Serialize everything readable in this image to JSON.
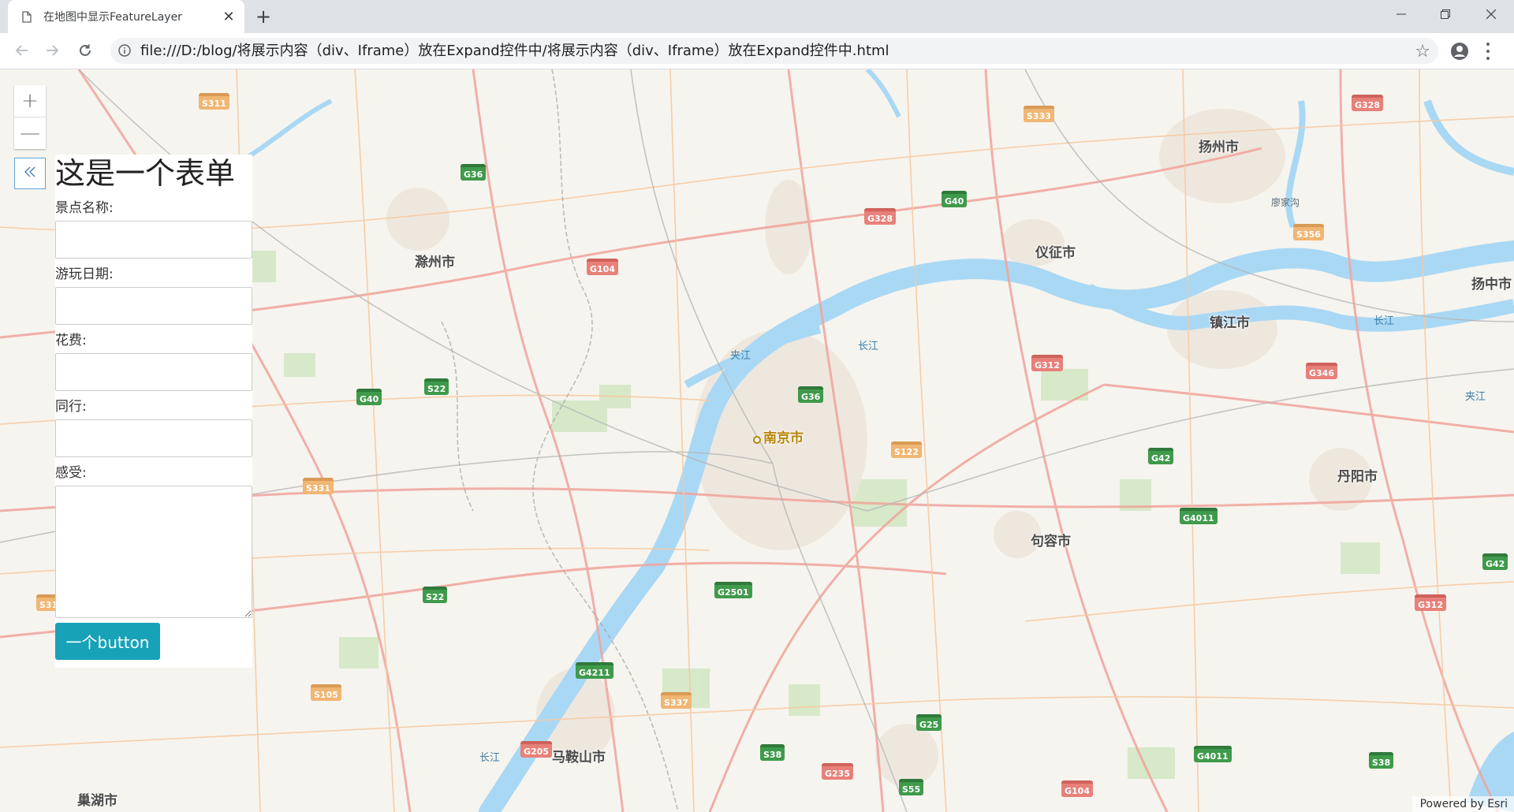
{
  "browser": {
    "tab_title": "在地图中显示FeatureLayer",
    "url": "file:///D:/blog/将展示内容（div、Iframe）放在Expand控件中/将展示内容（div、Iframe）放在Expand控件中.html",
    "close_glyph": "✕",
    "newtab_glyph": "+"
  },
  "map": {
    "places": [
      {
        "name": "扬州市",
        "cls": "place"
      },
      {
        "name": "仪征市",
        "cls": "place"
      },
      {
        "name": "滁州市",
        "cls": "place"
      },
      {
        "name": "镇江市",
        "cls": "place"
      },
      {
        "name": "扬中市",
        "cls": "place"
      },
      {
        "name": "南京市",
        "cls": "place capital"
      },
      {
        "name": "丹阳市",
        "cls": "place"
      },
      {
        "name": "句容市",
        "cls": "place"
      },
      {
        "name": "马鞍山市",
        "cls": "place"
      },
      {
        "name": "巢湖市",
        "cls": "place"
      }
    ],
    "water_labels": [
      "夹江",
      "长江",
      "长江",
      "长江",
      "夹江",
      "长江"
    ],
    "small_places": [
      "廖家沟"
    ],
    "shields": [
      {
        "text": "S311",
        "type": "s"
      },
      {
        "text": "S333",
        "type": "s"
      },
      {
        "text": "G328",
        "type": "r"
      },
      {
        "text": "G36",
        "type": "g"
      },
      {
        "text": "G40",
        "type": "g"
      },
      {
        "text": "G328",
        "type": "r"
      },
      {
        "text": "S356",
        "type": "s"
      },
      {
        "text": "G104",
        "type": "r"
      },
      {
        "text": "G312",
        "type": "r"
      },
      {
        "text": "G346",
        "type": "r"
      },
      {
        "text": "G40",
        "type": "g"
      },
      {
        "text": "S22",
        "type": "g"
      },
      {
        "text": "G36",
        "type": "g"
      },
      {
        "text": "S122",
        "type": "s"
      },
      {
        "text": "G42",
        "type": "g"
      },
      {
        "text": "S331",
        "type": "s"
      },
      {
        "text": "G4011",
        "type": "g"
      },
      {
        "text": "G42",
        "type": "g"
      },
      {
        "text": "S22",
        "type": "g"
      },
      {
        "text": "G2501",
        "type": "g"
      },
      {
        "text": "G312",
        "type": "r"
      },
      {
        "text": "S31",
        "type": "s"
      },
      {
        "text": "G4211",
        "type": "g"
      },
      {
        "text": "S105",
        "type": "s"
      },
      {
        "text": "S337",
        "type": "s"
      },
      {
        "text": "G25",
        "type": "g"
      },
      {
        "text": "G205",
        "type": "r"
      },
      {
        "text": "S38",
        "type": "g"
      },
      {
        "text": "G235",
        "type": "r"
      },
      {
        "text": "G4011",
        "type": "g"
      },
      {
        "text": "S38",
        "type": "g"
      },
      {
        "text": "S55",
        "type": "g"
      },
      {
        "text": "G104",
        "type": "r"
      }
    ],
    "attribution": "Powered by Esri"
  },
  "zoom": {
    "in_label": "+",
    "out_label": "—"
  },
  "form": {
    "heading": "这是一个表单",
    "fields": [
      {
        "label": "景点名称:",
        "value": ""
      },
      {
        "label": "游玩日期:",
        "value": ""
      },
      {
        "label": "花费:",
        "value": ""
      },
      {
        "label": "同行:",
        "value": ""
      },
      {
        "label": "感受:",
        "value": ""
      }
    ],
    "button_label": "一个button"
  },
  "colors": {
    "button": "#17a2b8",
    "water": "#a9d8f5",
    "road_major": "#f0a49b",
    "road_minor": "#f7c9a0"
  }
}
